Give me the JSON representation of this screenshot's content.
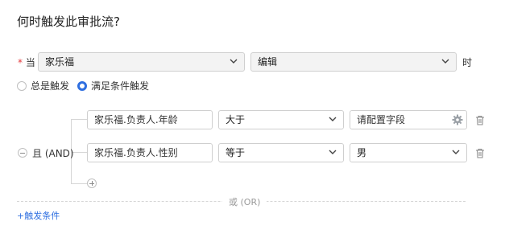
{
  "title": "何时触发此审批流?",
  "when": {
    "required_mark": "*",
    "label": "当",
    "entity_value": "家乐福",
    "action_value": "编辑",
    "suffix": "时"
  },
  "trigger_mode": {
    "options": [
      {
        "label": "总是触发",
        "selected": false
      },
      {
        "label": "满足条件触发",
        "selected": true
      }
    ]
  },
  "condition_group": {
    "logic_label": "且 (AND)",
    "rows": [
      {
        "field": "家乐福.负责人.年龄",
        "operator": "大于",
        "value": "请配置字段",
        "value_kind": "config"
      },
      {
        "field": "家乐福.负责人.性别",
        "operator": "等于",
        "value": "男",
        "value_kind": "select"
      }
    ]
  },
  "or_label": "或 (OR)",
  "add_trigger_label": "+触发条件",
  "colors": {
    "accent": "#2f6fe0",
    "required": "#e4393c"
  }
}
